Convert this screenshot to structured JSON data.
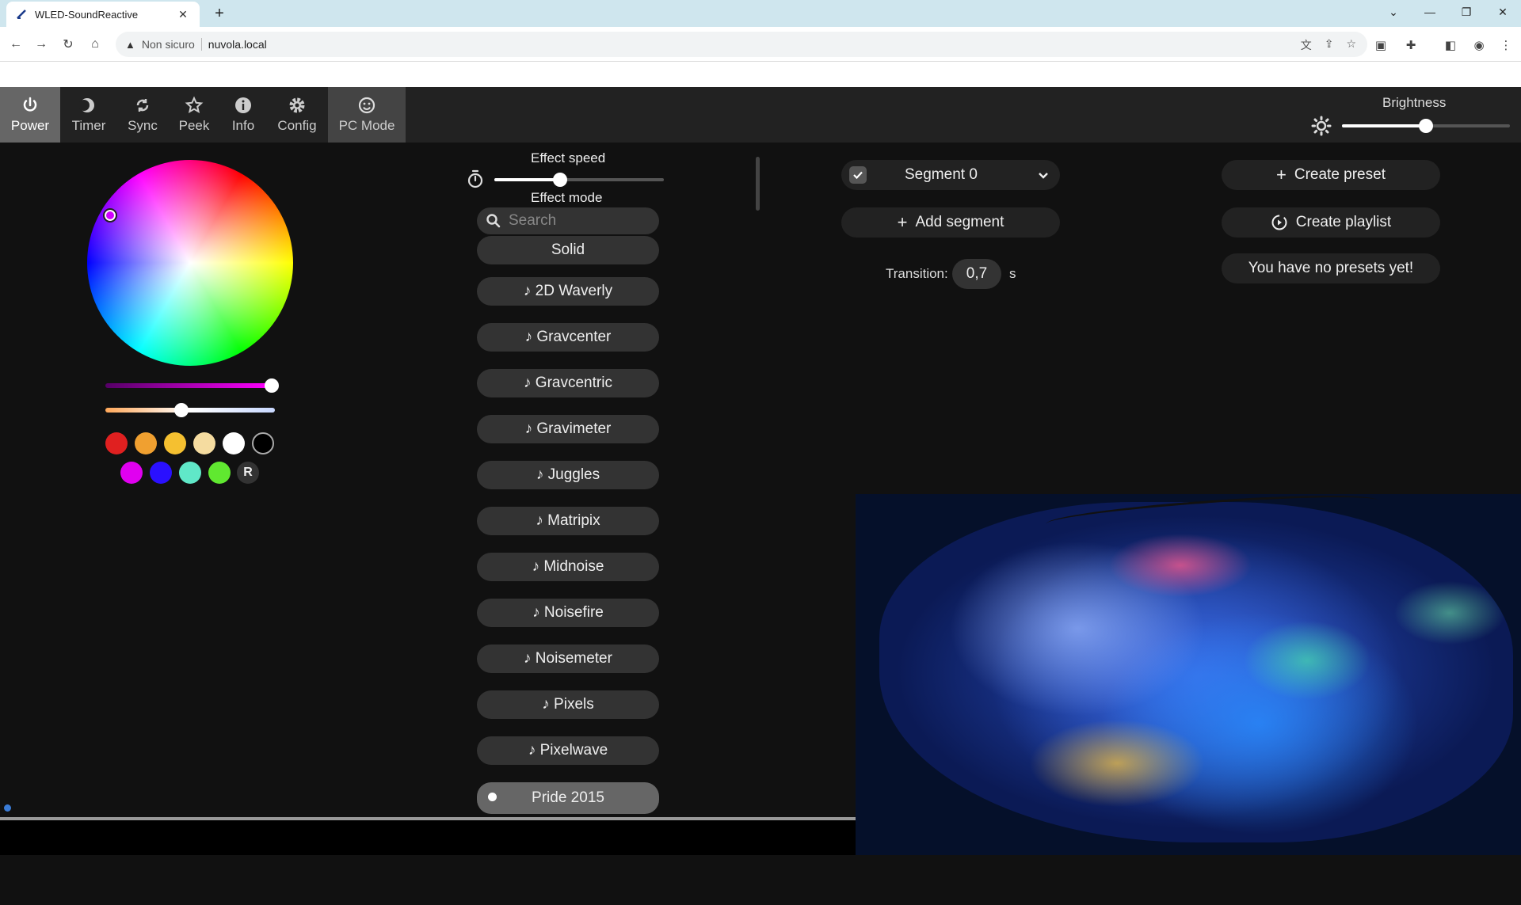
{
  "browser": {
    "tab_title": "WLED-SoundReactive",
    "new_tab_symbol": "+",
    "close_symbol": "✕",
    "security_label": "Non sicuro",
    "url": "nuvola.local"
  },
  "nav": {
    "items": [
      {
        "label": "Power",
        "icon": "power-icon"
      },
      {
        "label": "Timer",
        "icon": "moon-icon"
      },
      {
        "label": "Sync",
        "icon": "sync-icon"
      },
      {
        "label": "Peek",
        "icon": "star-icon"
      },
      {
        "label": "Info",
        "icon": "info-icon"
      },
      {
        "label": "Config",
        "icon": "gear-icon"
      },
      {
        "label": "PC Mode",
        "icon": "smiley-icon"
      }
    ]
  },
  "brightness": {
    "label": "Brightness",
    "value_fraction": 0.5
  },
  "colors": {
    "hue_slider_fraction": 1.0,
    "temp_slider_fraction": 0.45,
    "swatches": [
      "#e02020",
      "#f0a030",
      "#f5c030",
      "#f5dca0",
      "#ffffff",
      "#000000",
      "#e000f0",
      "#2a10ff",
      "#60e8c8",
      "#60e830"
    ],
    "random_label": "R"
  },
  "effects": {
    "speed_label": "Effect speed",
    "speed_fraction": 0.39,
    "mode_label": "Effect mode",
    "search_placeholder": "Search",
    "list": [
      "Solid",
      "♪ 2D Waverly",
      "♪ Gravcenter",
      "♪ Gravcentric",
      "♪ Gravimeter",
      "♪ Juggles",
      "♪ Matripix",
      "♪ Midnoise",
      "♪ Noisefire",
      "♪ Noisemeter",
      "♪ Pixels",
      "♪ Pixelwave",
      "Pride 2015"
    ],
    "selected_index": 12
  },
  "segments": {
    "segment_name": "Segment 0",
    "add_segment_label": "Add segment",
    "transition_label": "Transition:",
    "transition_value": "0,7",
    "transition_unit": "s"
  },
  "presets": {
    "create_preset_label": "Create preset",
    "create_playlist_label": "Create playlist",
    "empty_message": "You have no presets yet!"
  },
  "accent_colors": {
    "nav_bg": "#222222",
    "active_nav": "#666666",
    "button_bg": "#333333"
  }
}
